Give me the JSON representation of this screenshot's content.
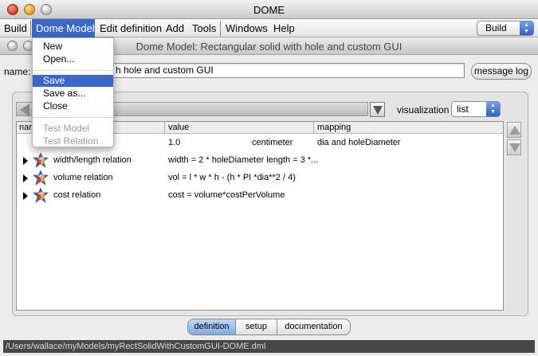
{
  "window": {
    "title": "DOME"
  },
  "menubar": {
    "items": [
      "Build",
      "Dome Model",
      "Edit definition",
      "Add",
      "Tools",
      "Windows",
      "Help"
    ],
    "active_item": "Dome Model",
    "build_select": "Build"
  },
  "file_menu": {
    "items": [
      {
        "label": "New",
        "enabled": true
      },
      {
        "label": "Open...",
        "enabled": true
      },
      {
        "label": "Save",
        "enabled": true,
        "highlighted": true
      },
      {
        "label": "Save as...",
        "enabled": true
      },
      {
        "label": "Close",
        "enabled": true
      },
      {
        "label": "Test Model",
        "enabled": false
      },
      {
        "label": "Test Relation",
        "enabled": false
      }
    ]
  },
  "model_window": {
    "title": "Dome Model: Rectangular solid with hole and custom GUI",
    "name_label": "name:",
    "name_value": "h hole and custom GUI",
    "message_log_button": "message log",
    "visualization_label": "visualization",
    "visualization_value": "list"
  },
  "table": {
    "headers": [
      "nam",
      "value",
      "mapping"
    ],
    "rows": [
      {
        "name": "",
        "value": "1.0",
        "unit": "centimeter",
        "mapping": "dia and holeDiameter"
      },
      {
        "name": "width/length relation",
        "value": "width = 2 * holeDiameter length = 3 *...",
        "unit": "",
        "mapping": ""
      },
      {
        "name": "volume relation",
        "value": "vol = l * w * h - (h * PI *dia**2 / 4)",
        "unit": "",
        "mapping": ""
      },
      {
        "name": "cost relation",
        "value": "cost = volume*costPerVolume",
        "unit": "",
        "mapping": ""
      }
    ]
  },
  "tabs": {
    "items": [
      "definition",
      "setup",
      "documentation"
    ],
    "selected": "definition"
  },
  "status": {
    "path": "/Users/wallace/myModels/myRectSolidWithCustomGUI-DOME.dml"
  },
  "icons": {
    "relation_icon": "relation-cube-icon",
    "expander_icon": "disclosure-triangle-icon"
  },
  "colors": {
    "menu_highlight": "#3968c8",
    "selected_tab": "#7fa9e3",
    "status_bar": "#474747"
  }
}
